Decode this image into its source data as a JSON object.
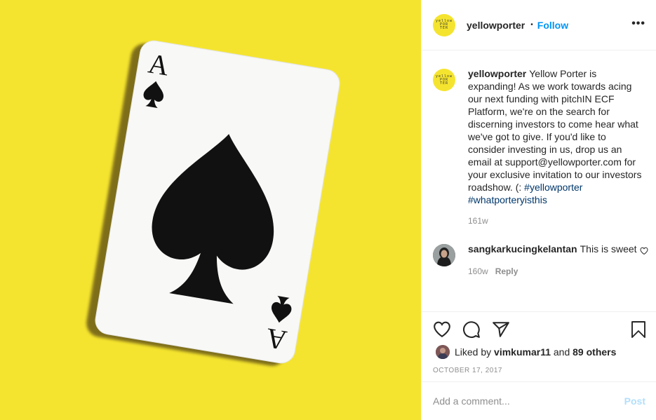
{
  "post": {
    "author": "yellowporter",
    "follow_label": "Follow",
    "separator": "•",
    "more_label": "•••",
    "avatar_logo_text": "yellow\nPOR\nTER"
  },
  "caption": {
    "author": "yellowporter",
    "text": "Yellow Porter is expanding! As we work towards acing our next funding with pitchIN ECF Platform, we're on the search for discerning investors to come hear what we've got to give. If you'd like to consider investing in us, drop us an email at support@yellowporter.com for your exclusive invitation to our investors roadshow. (: ",
    "hashtags": [
      "#yellowporter",
      "#whatporteryisthis"
    ],
    "age": "161w"
  },
  "comments": [
    {
      "author": "sangkarkucingkelantan",
      "text": "This is sweet",
      "age": "160w",
      "reply_label": "Reply"
    }
  ],
  "likes": {
    "prefix": "Liked by",
    "user": "vimkumar11",
    "joiner": "and",
    "others": "89 others"
  },
  "date": "OCTOBER 17, 2017",
  "composer": {
    "placeholder": "Add a comment...",
    "post_label": "Post"
  },
  "card": {
    "rank": "A",
    "suit": "spade"
  },
  "colors": {
    "background": "#f5e42f",
    "link": "#0095f6",
    "hashtag": "#00376b",
    "muted": "#8e8e8e",
    "post_disabled": "#b2dffc"
  },
  "icons": [
    "heart-icon",
    "comment-icon",
    "share-icon",
    "bookmark-icon",
    "more-icon"
  ]
}
